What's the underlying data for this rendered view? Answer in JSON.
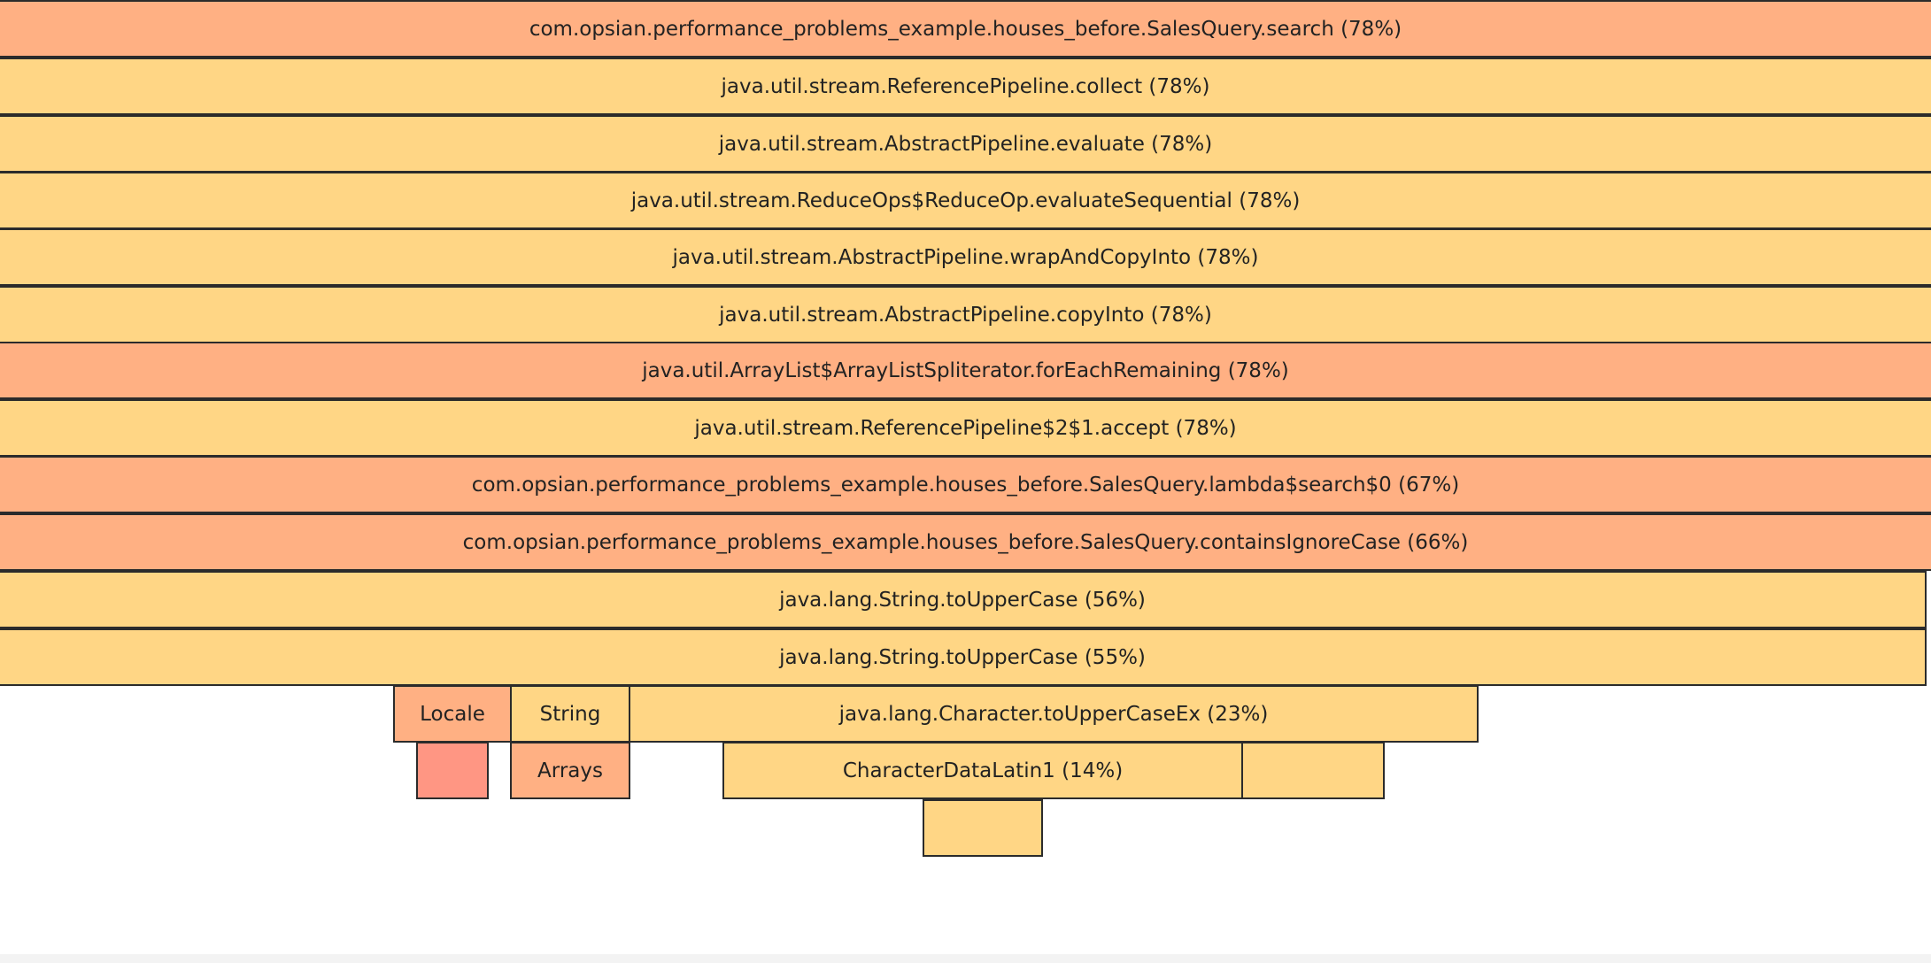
{
  "frames": [
    {
      "label": "com.opsian.performance_problems_example.houses_before.SalesQuery.search (78%)",
      "color": "#ffb083"
    },
    {
      "label": "java.util.stream.ReferencePipeline.collect (78%)",
      "color": "#ffd685"
    },
    {
      "label": "java.util.stream.AbstractPipeline.evaluate (78%)",
      "color": "#ffd685"
    },
    {
      "label": "java.util.stream.ReduceOps$ReduceOp.evaluateSequential (78%)",
      "color": "#ffd685"
    },
    {
      "label": "java.util.stream.AbstractPipeline.wrapAndCopyInto (78%)",
      "color": "#ffd685"
    },
    {
      "label": "java.util.stream.AbstractPipeline.copyInto (78%)",
      "color": "#ffd685"
    },
    {
      "label": "java.util.ArrayList$ArrayListSpliterator.forEachRemaining (78%)",
      "color": "#ffb083"
    },
    {
      "label": "java.util.stream.ReferencePipeline$2$1.accept (78%)",
      "color": "#ffd685"
    },
    {
      "label": "com.opsian.performance_problems_example.houses_before.SalesQuery.lambda$search$0 (67%)",
      "color": "#ffb083"
    },
    {
      "label": "com.opsian.performance_problems_example.houses_before.SalesQuery.containsIgnoreCase (66%)",
      "color": "#ffb083"
    },
    {
      "label": "java.lang.String.toUpperCase (56%)",
      "color": "#ffd685"
    },
    {
      "label": "java.lang.String.toUpperCase (55%)",
      "color": "#ffd685"
    },
    {
      "label": "Locale",
      "color": "#ffb083"
    },
    {
      "label": "String",
      "color": "#ffd685"
    },
    {
      "label": "java.lang.Character.toUpperCaseEx (23%)",
      "color": "#ffd685"
    },
    {
      "label": "",
      "color": "#ff9683"
    },
    {
      "label": "Arrays",
      "color": "#ffb083"
    },
    {
      "label": "CharacterDataLatin1 (14%)",
      "color": "#ffd685"
    },
    {
      "label": "",
      "color": "#ffd685"
    },
    {
      "label": "",
      "color": "#ffd685"
    }
  ]
}
